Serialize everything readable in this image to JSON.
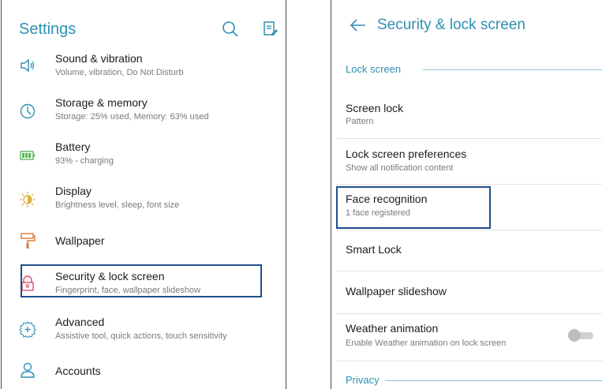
{
  "settings": {
    "title": "Settings",
    "icons": [
      "search-icon",
      "edit-list-icon"
    ],
    "items": [
      {
        "title": "Sound & vibration",
        "subtitle": "Volume, vibration, Do Not Disturb",
        "icon": "speaker-icon"
      },
      {
        "title": "Storage & memory",
        "subtitle": "Storage: 25% used, Memory: 63% used",
        "icon": "clock-icon"
      },
      {
        "title": "Battery",
        "subtitle": "93% - charging",
        "icon": "battery-icon"
      },
      {
        "title": "Display",
        "subtitle": "Brightness level, sleep, font size",
        "icon": "brightness-icon"
      },
      {
        "title": "Wallpaper",
        "subtitle": "",
        "icon": "paint-roller-icon"
      },
      {
        "title": "Security & lock screen",
        "subtitle": "Fingerprint, face, wallpaper slideshow",
        "icon": "lock-icon"
      },
      {
        "title": "Advanced",
        "subtitle": "Assistive tool, quick actions, touch sensitivity",
        "icon": "gear-plus-icon"
      },
      {
        "title": "Accounts",
        "subtitle": "",
        "icon": "person-icon"
      }
    ]
  },
  "security": {
    "title": "Security & lock screen",
    "back_icon": "back-arrow-icon",
    "section_lock": "Lock screen",
    "items": [
      {
        "title": "Screen lock",
        "subtitle": "Pattern"
      },
      {
        "title": "Lock screen preferences",
        "subtitle": "Show all notification content"
      },
      {
        "title": "Face recognition",
        "subtitle": "1 face registered"
      },
      {
        "title": "Smart Lock",
        "subtitle": ""
      },
      {
        "title": "Wallpaper slideshow",
        "subtitle": ""
      },
      {
        "title": "Weather animation",
        "subtitle": "Enable Weather animation on lock screen"
      }
    ],
    "weather_toggle_on": false,
    "section_privacy": "Privacy"
  },
  "colors": {
    "accent": "#2f8fb2",
    "battery": "#5bb85b",
    "display": "#e0b13a",
    "lock": "#d6506e",
    "highlight": "#1f4f8a"
  }
}
